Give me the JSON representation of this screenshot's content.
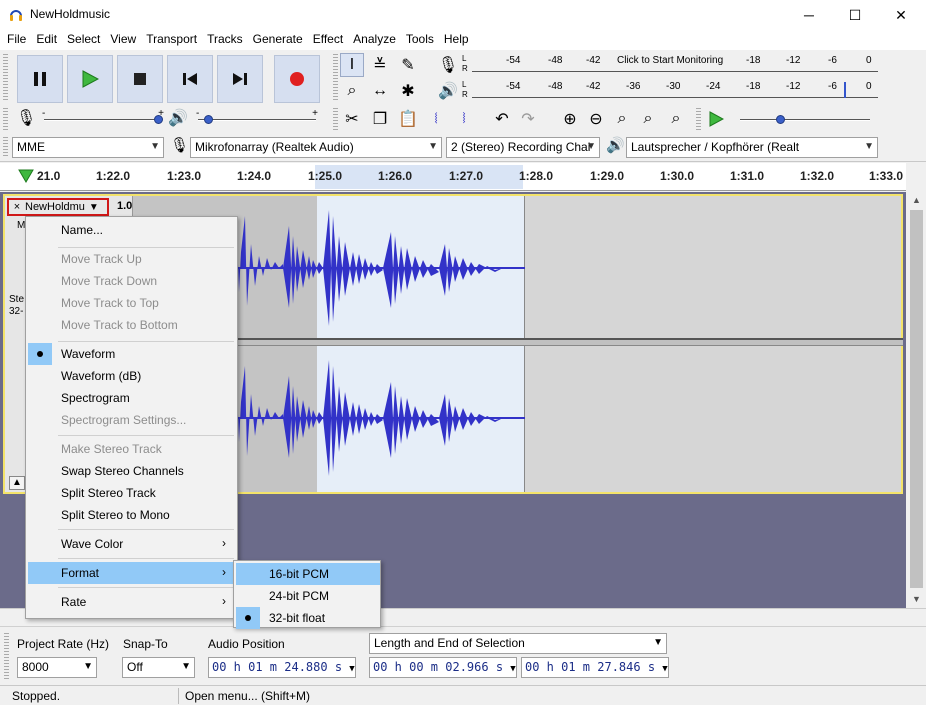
{
  "window": {
    "title": "NewHoldmusic",
    "minimize": "─",
    "maximize": "☐",
    "close": "✕"
  },
  "menubar": [
    "File",
    "Edit",
    "Select",
    "View",
    "Transport",
    "Tracks",
    "Generate",
    "Effect",
    "Analyze",
    "Tools",
    "Help"
  ],
  "meters": {
    "record_ticks": [
      "-54",
      "-48",
      "-42",
      "Click to Start Monitoring",
      "-18",
      "-12",
      "-6",
      "0"
    ],
    "play_ticks": [
      "-54",
      "-48",
      "-42",
      "-36",
      "-30",
      "-24",
      "-18",
      "-12",
      "-6",
      "0"
    ],
    "lr_top": "L",
    "lr_bottom": "R"
  },
  "sliders": {
    "minus": "-",
    "plus": "+"
  },
  "devices": {
    "host": "MME",
    "recording_device": "Mikrofonarray (Realtek Audio)",
    "channels": "2 (Stereo) Recording Chai",
    "playback_device": "Lautsprecher / Kopfhörer (Realt"
  },
  "ruler": {
    "labels": [
      "21.0",
      "1:22.0",
      "1:23.0",
      "1:24.0",
      "1:25.0",
      "1:26.0",
      "1:27.0",
      "1:28.0",
      "1:29.0",
      "1:30.0",
      "1:31.0",
      "1:32.0",
      "1:33.0"
    ]
  },
  "track": {
    "name": "NewHoldmu",
    "close": "×",
    "scale_top": "1.0",
    "partial_labels": [
      "M",
      "Ste",
      "32-"
    ]
  },
  "context_menu": {
    "items": [
      {
        "label": "Name...",
        "enabled": true
      },
      {
        "label": "Move Track Up",
        "enabled": false
      },
      {
        "label": "Move Track Down",
        "enabled": false
      },
      {
        "label": "Move Track to Top",
        "enabled": false
      },
      {
        "label": "Move Track to Bottom",
        "enabled": false
      },
      {
        "label": "Waveform",
        "enabled": true,
        "checked": true
      },
      {
        "label": "Waveform (dB)",
        "enabled": true
      },
      {
        "label": "Spectrogram",
        "enabled": true
      },
      {
        "label": "Spectrogram Settings...",
        "enabled": false
      },
      {
        "label": "Make Stereo Track",
        "enabled": false
      },
      {
        "label": "Swap Stereo Channels",
        "enabled": true
      },
      {
        "label": "Split Stereo Track",
        "enabled": true
      },
      {
        "label": "Split Stereo to Mono",
        "enabled": true
      },
      {
        "label": "Wave Color",
        "enabled": true,
        "submenu": true
      },
      {
        "label": "Format",
        "enabled": true,
        "submenu": true,
        "highlighted": true
      },
      {
        "label": "Rate",
        "enabled": true,
        "submenu": true
      }
    ],
    "submenu_arrow": "›"
  },
  "format_submenu": [
    {
      "label": "16-bit PCM",
      "highlighted": true
    },
    {
      "label": "24-bit PCM"
    },
    {
      "label": "32-bit float",
      "checked": true
    }
  ],
  "selection_toolbar": {
    "project_rate_label": "Project Rate (Hz)",
    "project_rate_value": "8000",
    "snap_to_label": "Snap-To",
    "snap_to_value": "Off",
    "audio_position_label": "Audio Position",
    "audio_position_value": "00 h 01 m 24.880 s",
    "selection_mode": "Length and End of Selection",
    "selection_length": "00 h 00 m 02.966 s",
    "selection_end": "00 h 01 m 27.846 s"
  },
  "status": {
    "state": "Stopped.",
    "hint": "Open menu... (Shift+M)"
  },
  "colors": {
    "accent": "#91c9f7",
    "waveform": "#3232c8",
    "track_border": "#f3e36a"
  }
}
